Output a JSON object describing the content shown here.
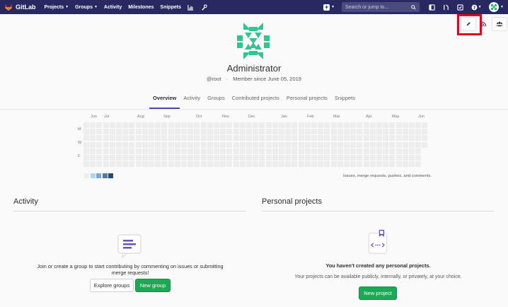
{
  "navbar": {
    "brand": "GitLab",
    "items": [
      {
        "label": "Projects",
        "dropdown": true
      },
      {
        "label": "Groups",
        "dropdown": true
      },
      {
        "label": "Activity",
        "dropdown": false
      },
      {
        "label": "Milestones",
        "dropdown": false
      },
      {
        "label": "Snippets",
        "dropdown": false
      }
    ],
    "search_placeholder": "Search or jump to...",
    "colors": {
      "bg": "#292961",
      "brand": "#e24329"
    }
  },
  "profile": {
    "name": "Administrator",
    "username": "@root",
    "separator": "·",
    "member_since": "Member since June 05, 2019"
  },
  "tabs": [
    "Overview",
    "Activity",
    "Groups",
    "Contributed projects",
    "Personal projects",
    "Snippets"
  ],
  "active_tab": "Overview",
  "calendar": {
    "months": [
      "Jun",
      "Jul",
      "Aug",
      "Sep",
      "Oct",
      "Nov",
      "Dec",
      "Jan",
      "Feb",
      "Mar",
      "Apr",
      "May",
      "Jun"
    ],
    "day_labels": [
      "M",
      "W",
      "F"
    ],
    "legend_colors": [
      "#ededed",
      "#acd5f2",
      "#7fa8c9",
      "#527ba0",
      "#254e77"
    ],
    "legend_text": "Issues, merge requests, pushes, and comments."
  },
  "activity": {
    "title": "Activity",
    "empty_text": "Join or create a group to start contributing by commenting on issues or submitting merge requests!",
    "explore_button": "Explore groups",
    "new_group_button": "New group"
  },
  "personal_projects": {
    "title": "Personal projects",
    "empty_title": "You haven't created any personal projects.",
    "empty_text": "Your projects can be available publicly, internally, or privately, at your choice.",
    "new_project_button": "New project"
  },
  "icons": {
    "edit": "pencil-icon",
    "rss": "rss-icon",
    "users": "users-icon"
  }
}
